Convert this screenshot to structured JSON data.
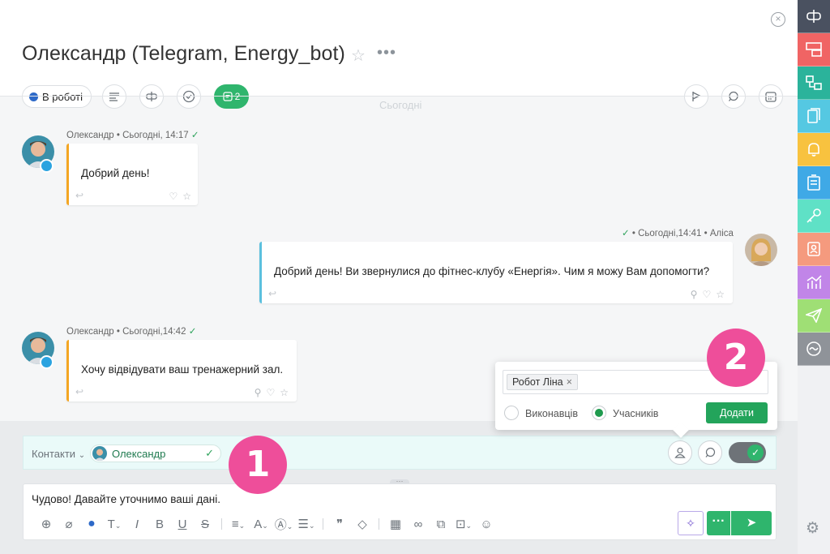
{
  "header": {
    "title": "Олександр (Telegram, Energy_bot)",
    "close_icon": "close-icon",
    "star_icon": "star-icon",
    "more_icon": "more-icon"
  },
  "toolbar": {
    "status_label": "В роботі",
    "status_color": "#2d69c8",
    "comments_count": "2"
  },
  "chat": {
    "date_divider": "Сьогодні",
    "messages": [
      {
        "author": "Олександр",
        "meta": "Сьогодні, 14:17",
        "text": "Добрий день!",
        "direction": "incoming"
      },
      {
        "author": "Аліса",
        "meta": "Сьогодні,14:41",
        "text": "Добрий день! Ви звернулися до фітнес-клубу «Енергія». Чим я можу Вам допомогти?",
        "direction": "outgoing"
      },
      {
        "author": "Олександр",
        "meta": "Сьогодні,14:42",
        "text": "Хочу відвідувати ваш тренажерний зал.",
        "direction": "incoming"
      }
    ]
  },
  "popup": {
    "selected_chip": "Робот Ліна",
    "option_executors": "Виконавців",
    "option_participants": "Учасників",
    "selected_option": "participants",
    "add_button": "Додати"
  },
  "contacts_bar": {
    "label": "Контакти",
    "contact_name": "Олександр"
  },
  "editor": {
    "text": "Чудово! Давайте уточнимо ваші дані."
  },
  "callouts": {
    "first": "1",
    "second": "2"
  },
  "rail": {
    "items": [
      {
        "icon": "crm-icon",
        "color": "#4a5160"
      },
      {
        "icon": "tasks-icon",
        "color": "#f06464"
      },
      {
        "icon": "deals-icon",
        "color": "#2bb39b"
      },
      {
        "icon": "documents-icon",
        "color": "#55c8e2"
      },
      {
        "icon": "notifications-icon",
        "color": "#f8c23f"
      },
      {
        "icon": "lists-icon",
        "color": "#3fa9e6"
      },
      {
        "icon": "keys-icon",
        "color": "#5fe1c6"
      },
      {
        "icon": "contacts-icon",
        "color": "#f59a7e"
      },
      {
        "icon": "analytics-icon",
        "color": "#c185e8"
      },
      {
        "icon": "send-icon",
        "color": "#9fdf75"
      },
      {
        "icon": "flow-icon",
        "color": "#8f9399"
      }
    ],
    "settings_icon": "gear-icon"
  }
}
